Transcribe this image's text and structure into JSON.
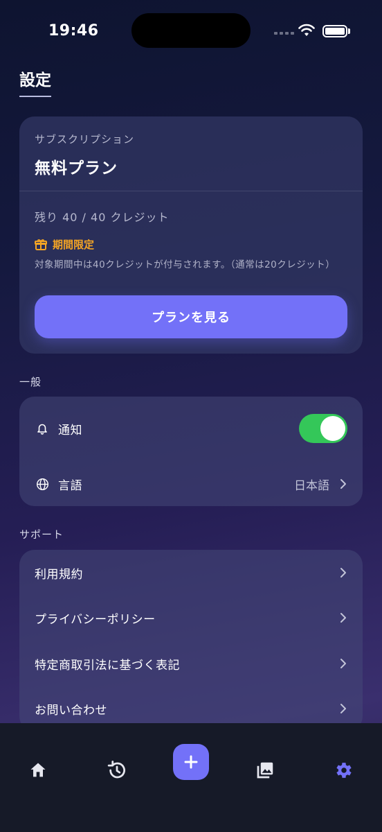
{
  "status": {
    "time": "19:46"
  },
  "page": {
    "title": "設定"
  },
  "subscription": {
    "label": "サブスクリプション",
    "plan_name": "無料プラン",
    "credits": "残り 40 / 40 クレジット",
    "limited_label": "期間限定",
    "note": "対象期間中は40クレジットが付与されます。（通常は20クレジット）",
    "button_label": "プランを見る",
    "colors": {
      "accent": "#7371f8",
      "limited": "#f5a524"
    }
  },
  "general": {
    "section_label": "一般",
    "notifications": {
      "label": "通知",
      "enabled": true,
      "icon": "bell-icon"
    },
    "language": {
      "label": "言語",
      "value": "日本語",
      "icon": "globe-icon"
    }
  },
  "support": {
    "section_label": "サポート",
    "items": [
      {
        "label": "利用規約"
      },
      {
        "label": "プライバシーポリシー"
      },
      {
        "label": "特定商取引法に基づく表記"
      },
      {
        "label": "お問い合わせ"
      }
    ]
  },
  "tabbar": {
    "items": [
      "home-icon",
      "history-icon",
      "add-icon",
      "gallery-icon",
      "settings-icon"
    ],
    "active": "settings-icon",
    "active_color": "#7371f8"
  }
}
